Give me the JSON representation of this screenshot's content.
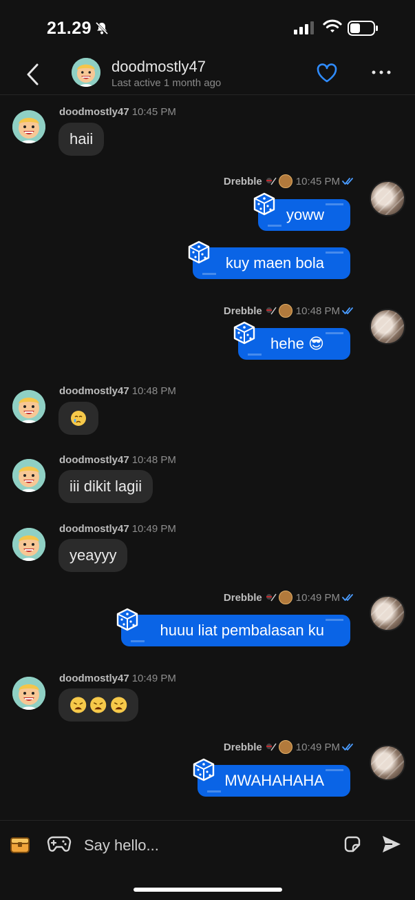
{
  "status_bar": {
    "time": "21.29"
  },
  "header": {
    "name": "doodmostly47",
    "subtitle": "Last active 1 month ago"
  },
  "messages": [
    {
      "sender": "doodmostly47",
      "time": "10:45 PM",
      "text": "haii"
    },
    {
      "sender": "Drebble",
      "time": "10:45 PM",
      "bubbles": [
        "yoww",
        "kuy maen bola"
      ]
    },
    {
      "sender": "Drebble",
      "time": "10:48 PM",
      "text": "hehe 😎"
    },
    {
      "sender": "doodmostly47",
      "time": "10:48 PM",
      "emoji": "crying-face"
    },
    {
      "sender": "doodmostly47",
      "time": "10:48 PM",
      "text": "iii dikit lagii"
    },
    {
      "sender": "doodmostly47",
      "time": "10:49 PM",
      "text": "yeayyy"
    },
    {
      "sender": "Drebble",
      "time": "10:49 PM",
      "text": "huuu liat pembalasan ku"
    },
    {
      "sender": "doodmostly47",
      "time": "10:49 PM",
      "emoji": "weary-face x3"
    },
    {
      "sender": "Drebble",
      "time": "10:49 PM",
      "text": "MWAHAHAHA"
    }
  ],
  "composer": {
    "placeholder": "Say hello..."
  },
  "colors": {
    "background": "#121212",
    "bubble_in": "#2b2b2b",
    "bubble_out": "#0a64e6",
    "accent": "#2f8cff"
  }
}
